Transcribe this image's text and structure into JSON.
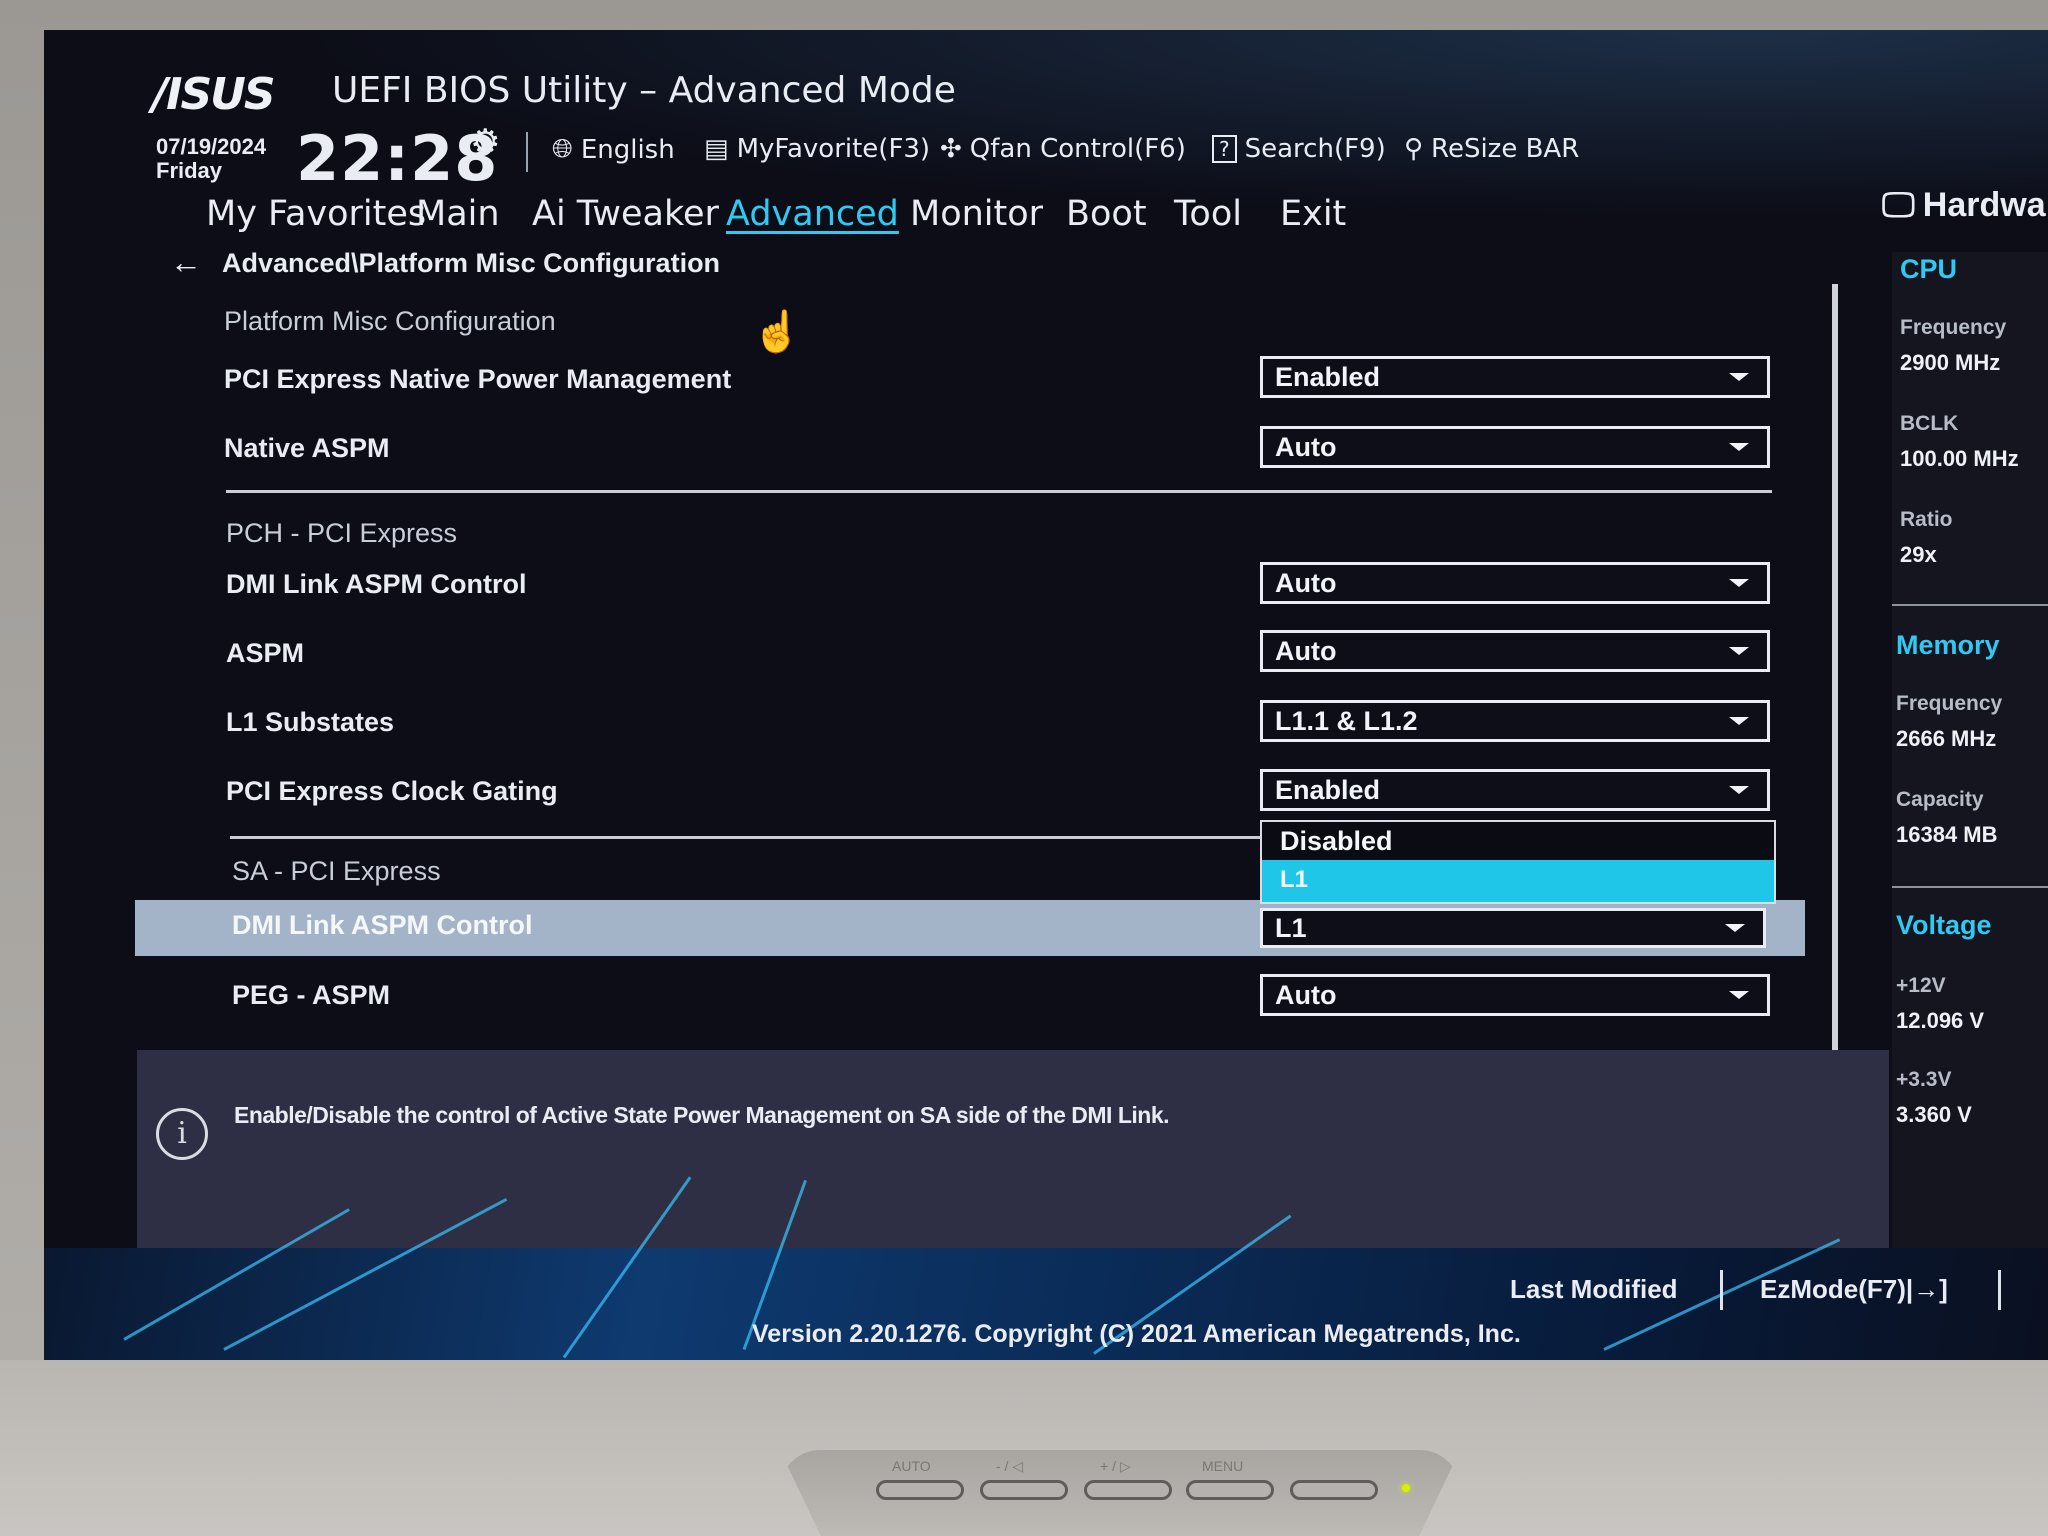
{
  "header": {
    "logo": "/ISUS",
    "title": "UEFI BIOS Utility – Advanced Mode",
    "date": "07/19/2024",
    "day": "Friday",
    "time": "22:28"
  },
  "toolbar": {
    "language": "English",
    "favorite": "MyFavorite(F3)",
    "qfan": "Qfan Control(F6)",
    "search": "Search(F9)",
    "resize_bar": "ReSize BAR"
  },
  "tabs": [
    {
      "label": "My Favorites",
      "active": false
    },
    {
      "label": "Main",
      "active": false
    },
    {
      "label": "Ai Tweaker",
      "active": false
    },
    {
      "label": "Advanced",
      "active": true
    },
    {
      "label": "Monitor",
      "active": false
    },
    {
      "label": "Boot",
      "active": false
    },
    {
      "label": "Tool",
      "active": false
    },
    {
      "label": "Exit",
      "active": false
    }
  ],
  "hardware_title": "Hardwa",
  "breadcrumb": "Advanced\\Platform Misc Configuration",
  "sections": {
    "platform": "Platform Misc Configuration",
    "pch": "PCH - PCI Express",
    "sa": "SA - PCI Express"
  },
  "settings": [
    {
      "label": "PCI Express Native Power Management",
      "value": "Enabled"
    },
    {
      "label": "Native ASPM",
      "value": "Auto"
    },
    {
      "label": "DMI Link ASPM Control",
      "value": "Auto"
    },
    {
      "label": "ASPM",
      "value": "Auto"
    },
    {
      "label": "L1 Substates",
      "value": "L1.1 & L1.2"
    },
    {
      "label": "PCI Express Clock Gating",
      "value": "Enabled"
    },
    {
      "label": "DMI Link ASPM Control",
      "value": "L1"
    },
    {
      "label": "PEG - ASPM",
      "value": "Auto"
    }
  ],
  "dropdown_menu": {
    "options": [
      "Disabled",
      "L1"
    ],
    "highlighted": "L1"
  },
  "help_text": "Enable/Disable the control of Active State Power Management on SA side of the DMI Link.",
  "sidebar": {
    "cpu": {
      "heading": "CPU",
      "frequency_label": "Frequency",
      "frequency": "2900 MHz",
      "bclk_label": "BCLK",
      "bclk": "100.00 MHz",
      "ratio_label": "Ratio",
      "ratio": "29x"
    },
    "memory": {
      "heading": "Memory",
      "frequency_label": "Frequency",
      "frequency": "2666 MHz",
      "capacity_label": "Capacity",
      "capacity": "16384 MB"
    },
    "voltage": {
      "heading": "Voltage",
      "v12_label": "+12V",
      "v12": "12.096 V",
      "v33_label": "+3.3V",
      "v33": "3.360 V"
    }
  },
  "footer": {
    "last_modified": "Last Modified",
    "ezmode": "EzMode(F7)|→]",
    "version": "Version 2.20.1276. Copyright (C) 2021 American Megatrends, Inc."
  },
  "monitor_buttons": [
    "AUTO",
    "- / ◁",
    "+ / ▷",
    "MENU"
  ],
  "colors": {
    "accent": "#2fc9f2",
    "selected_row": "#a4b4c8",
    "menu_highlight": "#1fc6e8",
    "background": "#0c0d17"
  }
}
